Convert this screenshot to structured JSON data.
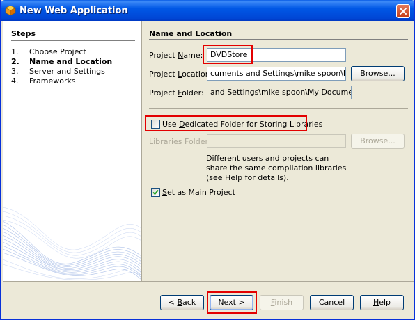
{
  "window": {
    "title": "New Web Application",
    "colors": {
      "titlebar": "#0054e3",
      "highlight": "#e30000",
      "panel": "#ece9d8"
    }
  },
  "icons": {
    "title": "netbeans-cube-icon",
    "close": "close-icon",
    "check": "checkmark-icon"
  },
  "steps": {
    "header": "Steps",
    "items": [
      {
        "num": "1.",
        "label": "Choose Project"
      },
      {
        "num": "2.",
        "label": "Name and Location"
      },
      {
        "num": "3.",
        "label": "Server and Settings"
      },
      {
        "num": "4.",
        "label": "Frameworks"
      }
    ],
    "current_index": 1
  },
  "main": {
    "section_title": "Name and Location",
    "project_name": {
      "label_pre": "Project ",
      "label_mnemonic": "N",
      "label_post": "ame:",
      "value": "DVDStore"
    },
    "project_location": {
      "label_pre": "Project ",
      "label_mnemonic": "L",
      "label_post": "ocation:",
      "value": "cuments and Settings\\mike spoon\\My Dc",
      "browse": "Browse..."
    },
    "project_folder": {
      "label_pre": "Project ",
      "label_mnemonic": "F",
      "label_post": "older:",
      "value": "and Settings\\mike spoon\\My Documents\\N"
    },
    "dedicated_folder": {
      "label_pre": "Use ",
      "label_mnemonic": "D",
      "label_post": "edicated Folder for Storing Libraries",
      "checked": false
    },
    "libraries_folder": {
      "label": "Libraries Folder:",
      "value": "",
      "browse": "Browse..."
    },
    "help_text": "Different users and projects can share the same compilation libraries (see Help for details).",
    "main_project": {
      "label_pre": "",
      "label_mnemonic": "S",
      "label_post": "et as Main Project",
      "checked": true
    }
  },
  "buttons": {
    "back": {
      "pre": "< ",
      "mnemonic": "B",
      "post": "ack"
    },
    "next": "Next >",
    "finish": {
      "mnemonic": "F",
      "post": "inish"
    },
    "cancel": "Cancel",
    "help": {
      "mnemonic": "H",
      "post": "elp"
    }
  }
}
